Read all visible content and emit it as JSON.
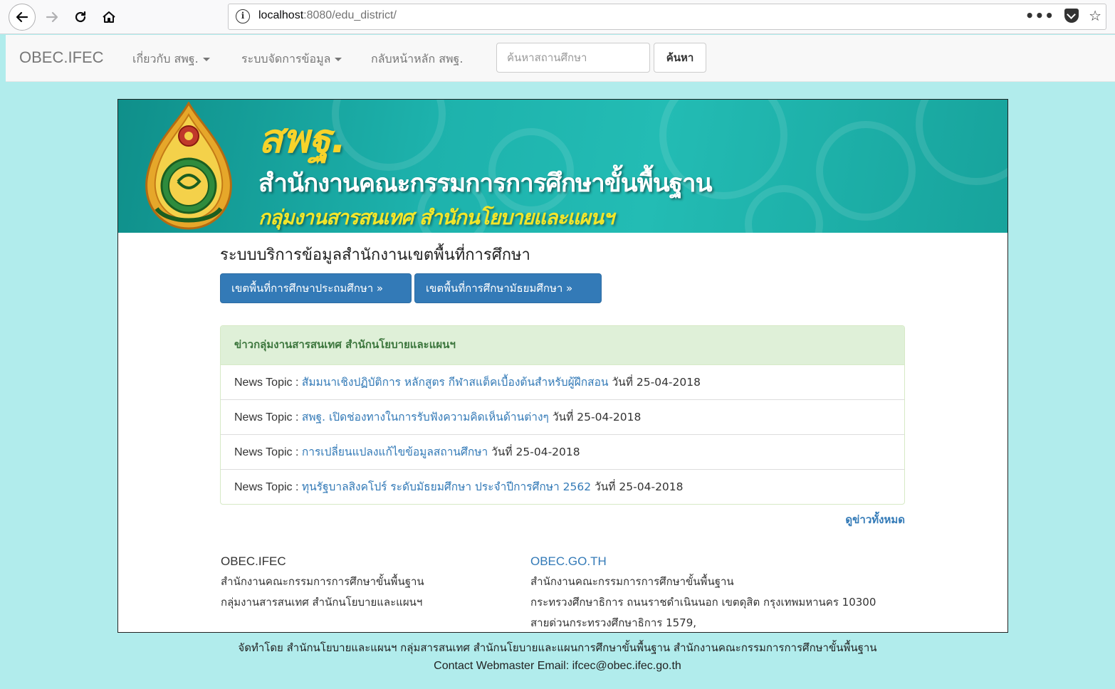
{
  "browser": {
    "url_host": "localhost",
    "url_rest": ":8080/edu_district/"
  },
  "navbar": {
    "brand": "OBEC.IFEC",
    "menu_about": "เกี่ยวกับ สพฐ.",
    "menu_data": "ระบบจัดการข้อมูล",
    "menu_home": "กลับหน้าหลัก สพฐ.",
    "search_placeholder": "ค้นหาสถานศึกษา",
    "search_button": "ค้นหา"
  },
  "banner": {
    "abbr": "สพฐ.",
    "title": "สำนักงานคณะกรรมการการศึกษาขั้นพื้นฐาน",
    "subtitle": "กลุ่มงานสารสนเทศ สำนักนโยบายและแผนฯ"
  },
  "main": {
    "heading": "ระบบบริการข้อมูลสำนักงานเขตพื้นที่การศึกษา",
    "btn_primary_district": "เขตพื้นที่การศึกษาประถมศึกษา »",
    "btn_secondary_district": "เขตพื้นที่การศึกษามัธยมศึกษา »"
  },
  "news": {
    "heading": "ข่าวกลุ่มงานสารสนเทศ สำนักนโยบายและแผนฯ",
    "items": [
      {
        "prefix": "News Topic : ",
        "title": "สัมมนาเชิงปฏิบัติการ หลักสูตร กีฬาสแต็คเบื้องต้นสำหรับผู้ฝึกสอน",
        "date": " วันที่ 25-04-2018"
      },
      {
        "prefix": "News Topic : ",
        "title": "สพฐ. เปิดช่องทางในการรับฟังความคิดเห็นด้านต่างๆ",
        "date": " วันที่ 25-04-2018"
      },
      {
        "prefix": "News Topic : ",
        "title": "การเปลี่ยนแปลงแก้ไขข้อมูลสถานศึกษา",
        "date": " วันที่ 25-04-2018"
      },
      {
        "prefix": "News Topic : ",
        "title": "ทุนรัฐบาลสิงคโปร์ ระดับมัธยมศึกษา ประจำปีการศึกษา 2562",
        "date": " วันที่ 25-04-2018"
      }
    ],
    "all_link": "ดูข่าวทั้งหมด"
  },
  "footer": {
    "col1": {
      "title": "OBEC.IFEC",
      "line1": "สำนักงานคณะกรรมการการศึกษาขั้นพื้นฐาน",
      "line2": "กลุ่มงานสารสนเทศ สำนักนโยบายและแผนฯ"
    },
    "col2": {
      "title": "OBEC.GO.TH",
      "line1": "สำนักงานคณะกรรมการการศึกษาขั้นพื้นฐาน",
      "line2": "กระทรวงศึกษาธิการ ถนนราชดำเนินนอก เขตดุสิต กรุงเทพมหานคร 10300",
      "line3": "สายด่วนกระทรวงศึกษาธิการ 1579,"
    },
    "credit": "จัดทำโดย สำนักนโยบายและแผนฯ กลุ่มสารสนเทศ สำนักนโยบายและแผนการศึกษาขั้นพื้นฐาน สำนักงานคณะกรรมการการศึกษาขั้นพื้นฐาน",
    "contact": "Contact Webmaster Email: ifcec@obec.ifec.go.th"
  }
}
